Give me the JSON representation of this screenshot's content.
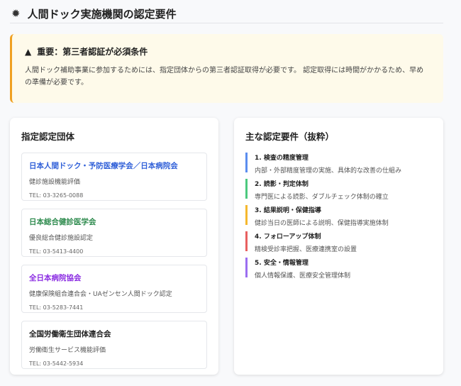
{
  "header": {
    "icon": "gear-icon",
    "title": "人間ドック実施機関の認定要件"
  },
  "alert": {
    "icon": "warning-icon",
    "title": "重要：第三者認証が必須条件",
    "body": "人間ドック補助事業に参加するためには、指定団体からの第三者認証取得が必要です。 認定取得には時間がかかるため、早めの準備が必要です。",
    "accent": "#f0a020"
  },
  "orgs": {
    "title": "指定認定団体",
    "items": [
      {
        "name": "日本人間ドック・予防医療学会／日本病院会",
        "desc": "健診施設機能評価",
        "tel": "TEL: 03-3265-0088",
        "color": "#2f5fd8"
      },
      {
        "name": "日本総合健診医学会",
        "desc": "優良総合健診施設認定",
        "tel": "TEL: 03-5413-4400",
        "color": "#2e8b4e"
      },
      {
        "name": "全日本病院協会",
        "desc": "健康保険組合連合会・UAゼンセン人間ドック認定",
        "tel": "TEL: 03-5283-7441",
        "color": "#8a2be2"
      },
      {
        "name": "全国労働衛生団体連合会",
        "desc": "労働衛生サービス機能評価",
        "tel": "TEL: 03-5442-5934",
        "color": "#222222"
      }
    ]
  },
  "reqs": {
    "title": "主な認定要件（抜粋）",
    "items": [
      {
        "name": "1. 検査の精度管理",
        "desc": "内部・外部精度管理の実施、具体的な改善の仕組み",
        "color": "#5b8def"
      },
      {
        "name": "2. 読影・判定体制",
        "desc": "専門医による読影、ダブルチェック体制の確立",
        "color": "#4cc97e"
      },
      {
        "name": "3. 結果説明・保健指導",
        "desc": "健診当日の医師による説明、保健指導実施体制",
        "color": "#f5b82e"
      },
      {
        "name": "4. フォローアップ体制",
        "desc": "精検受診率把握、医療連携室の設置",
        "color": "#e86060"
      },
      {
        "name": "5. 安全・情報管理",
        "desc": "個人情報保護、医療安全管理体制",
        "color": "#9b6ef0"
      }
    ]
  }
}
